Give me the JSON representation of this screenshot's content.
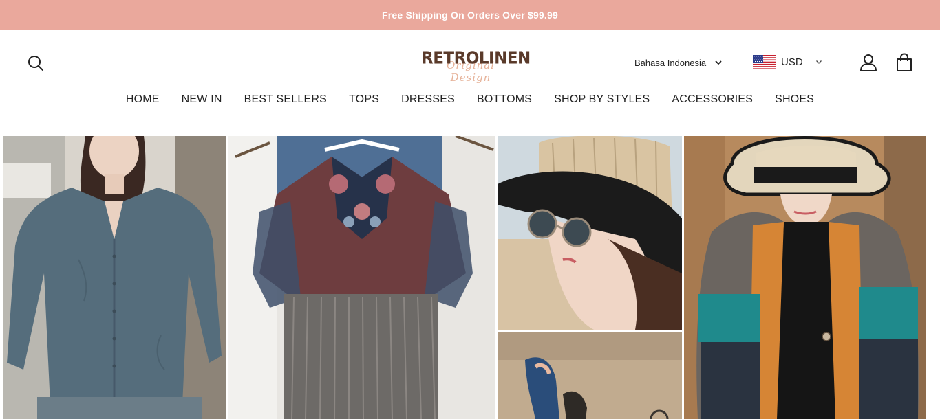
{
  "announcement": {
    "text": "Free Shipping On Orders Over $99.99"
  },
  "header": {
    "logo": {
      "main": "RETROLINEN",
      "script": "Original Design"
    },
    "language": {
      "selected": "Bahasa Indonesia"
    },
    "currency": {
      "selected": "USD"
    }
  },
  "nav": {
    "items": [
      {
        "label": "HOME"
      },
      {
        "label": "NEW IN"
      },
      {
        "label": "BEST SELLERS"
      },
      {
        "label": "TOPS"
      },
      {
        "label": "DRESSES"
      },
      {
        "label": "BOTTOMS"
      },
      {
        "label": "SHOP BY STYLES"
      },
      {
        "label": "ACCESSORIES"
      },
      {
        "label": "SHOES"
      }
    ]
  },
  "icons": {
    "search": "search-icon",
    "account": "user-icon",
    "cart": "shopping-bag-icon",
    "dropdown": "chevron-down-icon",
    "flag": "us-flag-icon"
  },
  "colors": {
    "announcement_bg": "#eaa89c",
    "logo_brown": "#5a3a2a",
    "text": "#222222"
  }
}
